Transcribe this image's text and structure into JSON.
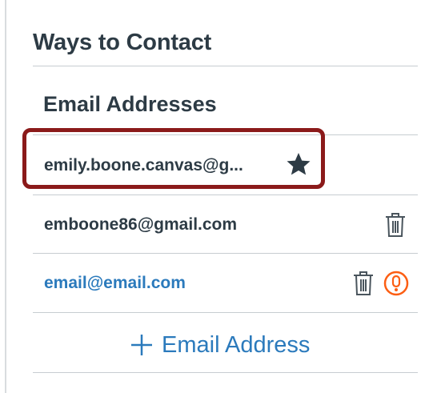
{
  "section": {
    "title": "Ways to Contact"
  },
  "email_addresses": {
    "heading": "Email Addresses",
    "items": [
      {
        "address": "emily.boone.canvas@g...",
        "status": "default",
        "icon": "star-icon"
      },
      {
        "address": "emboone86@gmail.com",
        "status": "confirmed",
        "icon": "trash-icon"
      },
      {
        "address": "email@email.com",
        "status": "unconfirmed",
        "icon": "trash-icon",
        "warning_icon": "warning-icon"
      }
    ],
    "add_label": "Email Address"
  },
  "colors": {
    "text": "#2d3b45",
    "link": "#2b7abc",
    "highlight": "#8b1a1a",
    "warning": "#fc5e13",
    "divider": "#c7cdd1"
  }
}
